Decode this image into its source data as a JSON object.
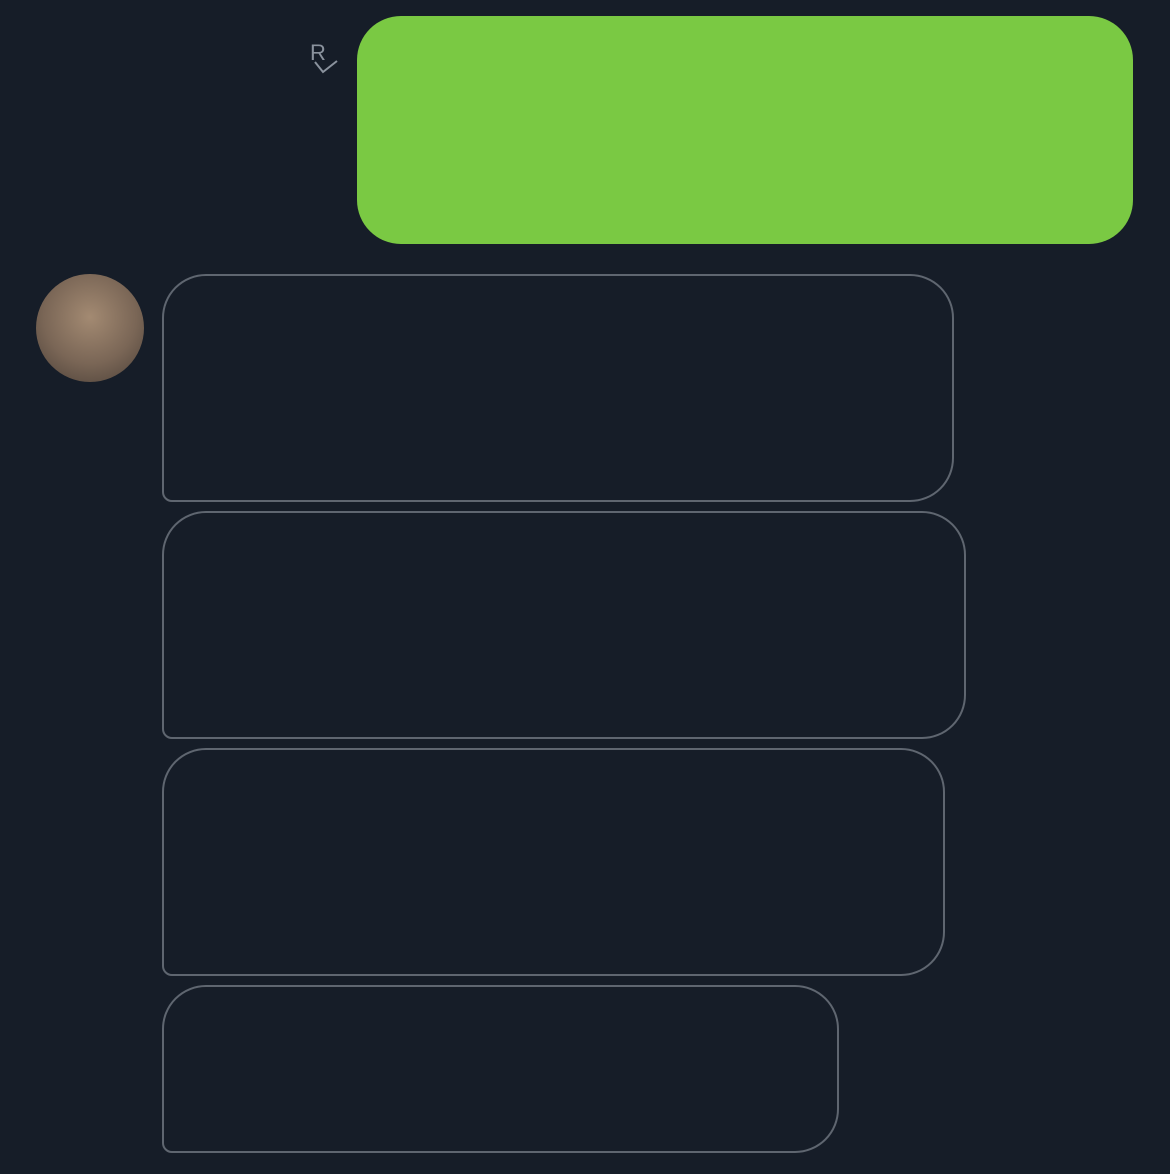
{
  "colors": {
    "background": "#161d28",
    "sent_bubble": "#7ac943",
    "received_border": "#5f6670",
    "text": "#ffffff",
    "receipt": "#8a929d"
  },
  "read_receipt": {
    "letter": "R",
    "icon": "checkmark-icon"
  },
  "sent": {
    "text": ""
  },
  "received": [
    {
      "text": ""
    },
    {
      "text": ""
    },
    {
      "text": ""
    },
    {
      "text": ""
    }
  ]
}
